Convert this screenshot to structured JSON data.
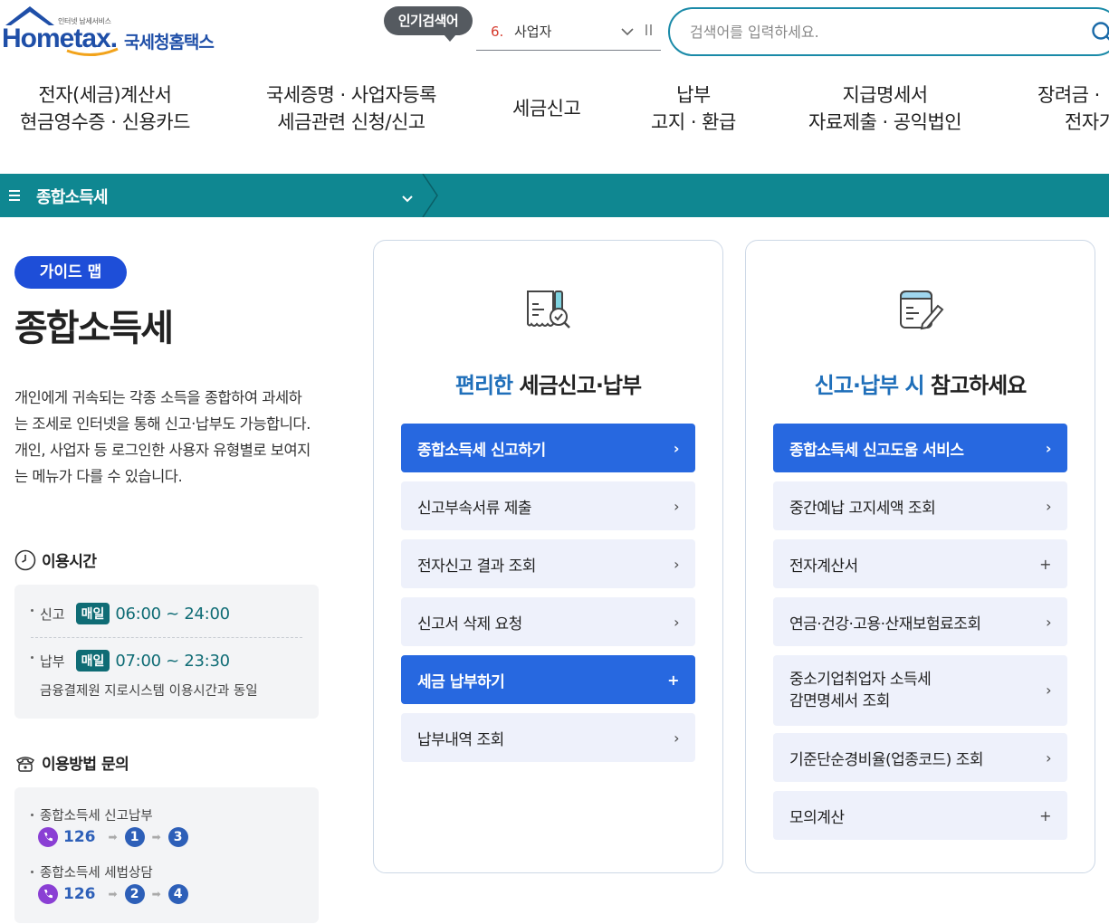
{
  "header": {
    "logo_small": "인터넷 납세서비스",
    "logo_main": "Hometax.",
    "logo_ko": "국세청홈택스",
    "popular_label": "인기검색어",
    "popular_rank": "6.",
    "popular_word": "사업자",
    "search_placeholder": "검색어를 입력하세요."
  },
  "gnb": [
    {
      "line1": "전자(세금)계산서",
      "line2": "현금영수증 · 신용카드"
    },
    {
      "line1": "국세증명 · 사업자등록",
      "line2": "세금관련 신청/신고"
    },
    {
      "line1": "세금신고",
      "line2": ""
    },
    {
      "line1": "납부",
      "line2": "고지 · 환급"
    },
    {
      "line1": "지급명세서",
      "line2": "자료제출 · 공익법인"
    },
    {
      "line1": "장려금 ·",
      "line2": "전자기"
    }
  ],
  "menu_bar": {
    "current": "종합소득세",
    "color": "#0f8791"
  },
  "left": {
    "guide_label": "가이드 맵",
    "title": "종합소득세",
    "description": "개인에게 귀속되는 각종 소득을 종합하여 과세하는 조세로 인터넷을 통해 신고·납부도 가능합니다. 개인, 사업자 등 로그인한 사용자 유형별로 보여지는 메뉴가 다를 수 있습니다.",
    "hours_title": "이용시간",
    "hours": [
      {
        "label": "신고",
        "badge": "매일",
        "time": "06:00 ~ 24:00"
      },
      {
        "label": "납부",
        "badge": "매일",
        "time": "07:00 ~ 23:30"
      }
    ],
    "hours_note": "금융결제원 지로시스템 이용시간과 동일",
    "inquiry_title": "이용방법 문의",
    "inquiries": [
      {
        "label": "종합소득세 신고납부",
        "number": "126",
        "steps": [
          "1",
          "3"
        ]
      },
      {
        "label": "종합소득세 세법상담",
        "number": "126",
        "steps": [
          "2",
          "4"
        ]
      }
    ]
  },
  "card1": {
    "title_highlight": "편리한",
    "title_rest": "세금신고·납부",
    "buttons": [
      {
        "label": "종합소득세 신고하기",
        "suffix": "›"
      },
      {
        "label": "신고부속서류 제출",
        "suffix": "›"
      },
      {
        "label": "전자신고 결과 조회",
        "suffix": "›"
      },
      {
        "label": "신고서 삭제 요청",
        "suffix": "›"
      },
      {
        "label": "세금 납부하기",
        "suffix": "+"
      },
      {
        "label": "납부내역 조회",
        "suffix": "›"
      }
    ]
  },
  "card2": {
    "title_highlight": "신고·납부 시",
    "title_rest": "참고하세요",
    "buttons": [
      {
        "label": "종합소득세 신고도움 서비스",
        "suffix": "›"
      },
      {
        "label": "중간예납 고지세액 조회",
        "suffix": "›"
      },
      {
        "label": "전자계산서",
        "suffix": "+"
      },
      {
        "label": "연금·건강·고용·산재보험료조회",
        "suffix": "›"
      },
      {
        "label": "중소기업취업자 소득세\n감면명세서 조회",
        "suffix": "›"
      },
      {
        "label": "기준단순경비율(업종코드) 조회",
        "suffix": "›"
      },
      {
        "label": "모의계산",
        "suffix": "+"
      }
    ]
  },
  "colors": {
    "primary": "#2768e0",
    "teal": "#0f8791",
    "accent_text": "#1f6fba"
  }
}
